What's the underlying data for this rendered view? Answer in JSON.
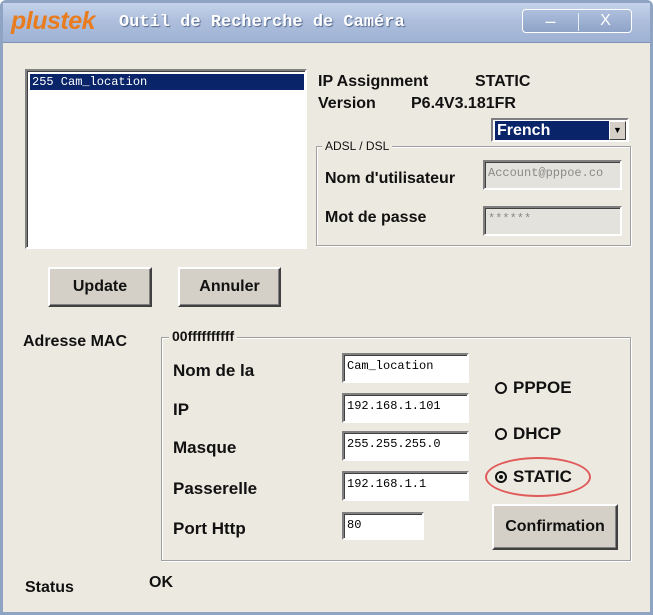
{
  "window": {
    "logo": "plustek",
    "title": "Outil de Recherche de Caméra",
    "minimize_symbol": "–",
    "close_symbol": "X"
  },
  "camera_list": {
    "items": [
      "255 Cam_location"
    ],
    "selected_index": 0
  },
  "info": {
    "ip_assignment_label": "IP Assignment",
    "ip_assignment_value": "STATIC",
    "version_label": "Version",
    "version_value": "P6.4V3.181FR"
  },
  "language": {
    "selected": "French"
  },
  "adsl": {
    "legend": "ADSL / DSL",
    "username_label": "Nom d'utilisateur",
    "username_value": "Account@pppoe.co",
    "password_label": "Mot de passe",
    "password_value": "******"
  },
  "buttons": {
    "update": "Update",
    "cancel": "Annuler",
    "confirm": "Confirmation"
  },
  "network": {
    "mac_label": "Adresse MAC",
    "mac_value": "00ffffffffff",
    "name_label": "Nom de la",
    "name_value": "Cam_location",
    "ip_label": "IP",
    "ip_value": "192.168.1.101",
    "mask_label": "Masque",
    "mask_value": "255.255.255.0",
    "gateway_label": "Passerelle",
    "gateway_value": "192.168.1.1",
    "port_label": "Port Http",
    "port_value": "80"
  },
  "mode": {
    "options": [
      "PPPOE",
      "DHCP",
      "STATIC"
    ],
    "selected": "STATIC"
  },
  "status": {
    "label": "Status",
    "value": "OK"
  },
  "colors": {
    "accent_orange": "#e87c1e",
    "selection_blue": "#0a246a",
    "highlight_red": "#e05a5a"
  }
}
